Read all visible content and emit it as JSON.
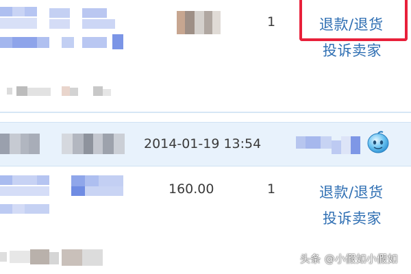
{
  "rows": [
    {
      "quantity": "1",
      "actions": {
        "refund_label": "退款/退货",
        "complain_label": "投诉卖家"
      }
    },
    {
      "quantity": "1",
      "price": "160.00",
      "actions": {
        "refund_label": "退款/退货",
        "complain_label": "投诉卖家"
      }
    }
  ],
  "order_header": {
    "time": "2014-01-19 13:54"
  },
  "watermark": "头条 @小假如小假如",
  "colors": {
    "link": "#2f6fb3",
    "highlight": "#e8203a",
    "header_bg": "#e8f2fc"
  },
  "icons": {
    "chat": "chat-bubble-icon"
  }
}
